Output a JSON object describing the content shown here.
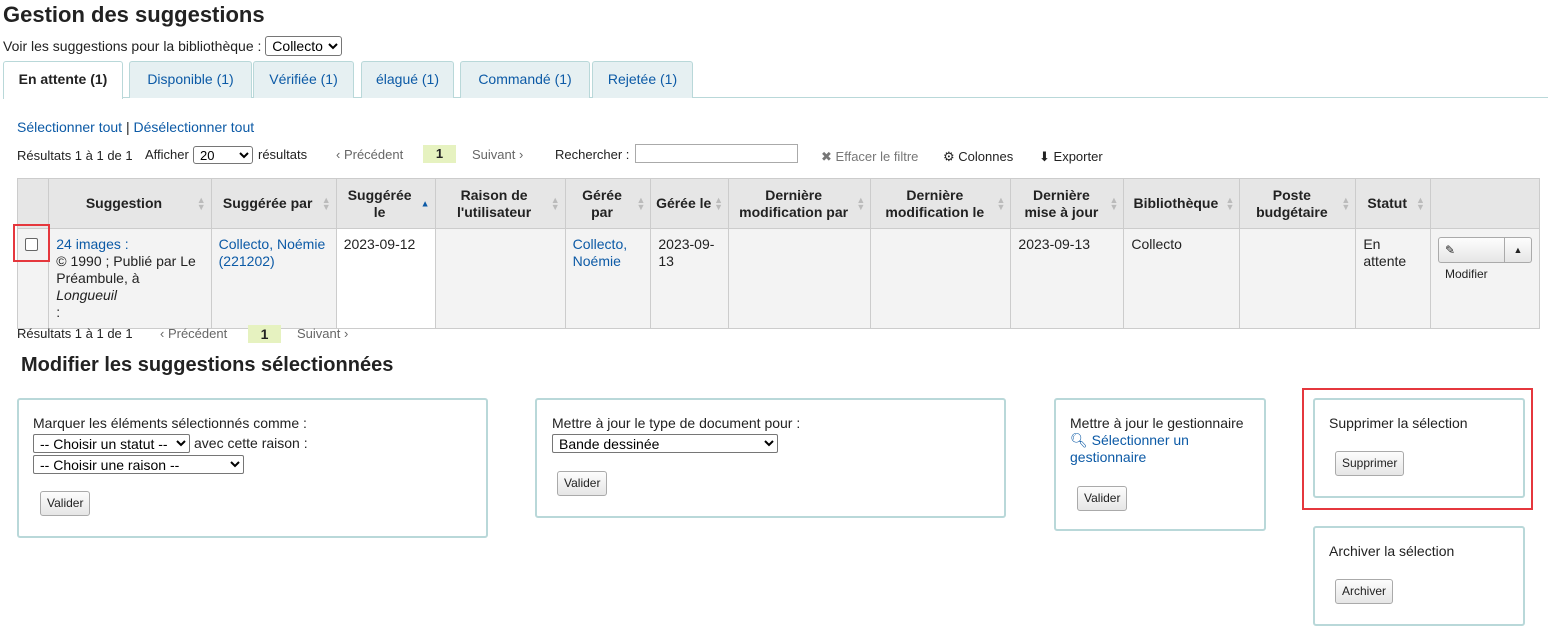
{
  "page": {
    "title": "Gestion des suggestions"
  },
  "library_filter": {
    "label": "Voir les suggestions pour la bibliothèque :",
    "selected": "Collecto"
  },
  "tabs": [
    {
      "label": "En attente (1)",
      "active": true
    },
    {
      "label": "Disponible (1)"
    },
    {
      "label": "Vérifiée (1)"
    },
    {
      "label": "élagué (1)"
    },
    {
      "label": "Commandé (1)"
    },
    {
      "label": "Rejetée (1)"
    }
  ],
  "selection": {
    "select_all": "Sélectionner tout",
    "separator": "|",
    "deselect_all": "Désélectionner tout"
  },
  "toolbar": {
    "results": "Résultats 1 à 1 de 1",
    "show_label": "Afficher",
    "show_value": "20",
    "results_suffix": "résultats",
    "prev": "‹ Précédent",
    "page": "1",
    "next": "Suivant ›",
    "search_label": "Rechercher :",
    "clear_filter": "Effacer le filtre",
    "columns": "Colonnes",
    "export": "Exporter"
  },
  "table": {
    "headers": [
      "Suggestion",
      "Suggérée par",
      "Suggérée le",
      "Raison de l'utilisateur",
      "Gérée par",
      "Gérée le",
      "Dernière modification par",
      "Dernière modification le",
      "Dernière mise à jour",
      "Bibliothèque",
      "Poste budgétaire",
      "Statut"
    ],
    "row": {
      "title_link": "24 images :",
      "pub_line": "© 1990 ; Publié par Le Préambule, à",
      "pub_place": "Longueuil",
      "pub_end": ":",
      "suggested_by": "Collecto, Noémie (221202)",
      "suggested_on": "2023-09-12",
      "reason": "",
      "managed_by": "Collecto, Noémie",
      "managed_on": "2023-09-13",
      "last_mod_by": "",
      "last_mod_on": "",
      "last_update": "2023-09-13",
      "library": "Collecto",
      "budget": "",
      "status": "En attente",
      "modify": "Modifier"
    }
  },
  "bottom_pager": {
    "results": "Résultats 1 à 1 de 1",
    "prev": "‹ Précédent",
    "page": "1",
    "next": "Suivant ›"
  },
  "modify_section": {
    "title": "Modifier les suggestions sélectionnées",
    "mark": {
      "label": "Marquer les éléments sélectionnés comme :",
      "status_select": "-- Choisir un statut --",
      "reason_label": "avec cette raison :",
      "reason_select": "-- Choisir une raison --",
      "button": "Valider"
    },
    "doctype": {
      "label": "Mettre à jour le type de document pour :",
      "select": "Bande dessinée",
      "button": "Valider"
    },
    "manager": {
      "label": "Mettre à jour le gestionnaire",
      "link": "Sélectionner un gestionnaire",
      "button": "Valider"
    },
    "delete": {
      "label": "Supprimer la sélection",
      "button": "Supprimer"
    },
    "archive": {
      "label": "Archiver la sélection",
      "button": "Archiver"
    }
  }
}
